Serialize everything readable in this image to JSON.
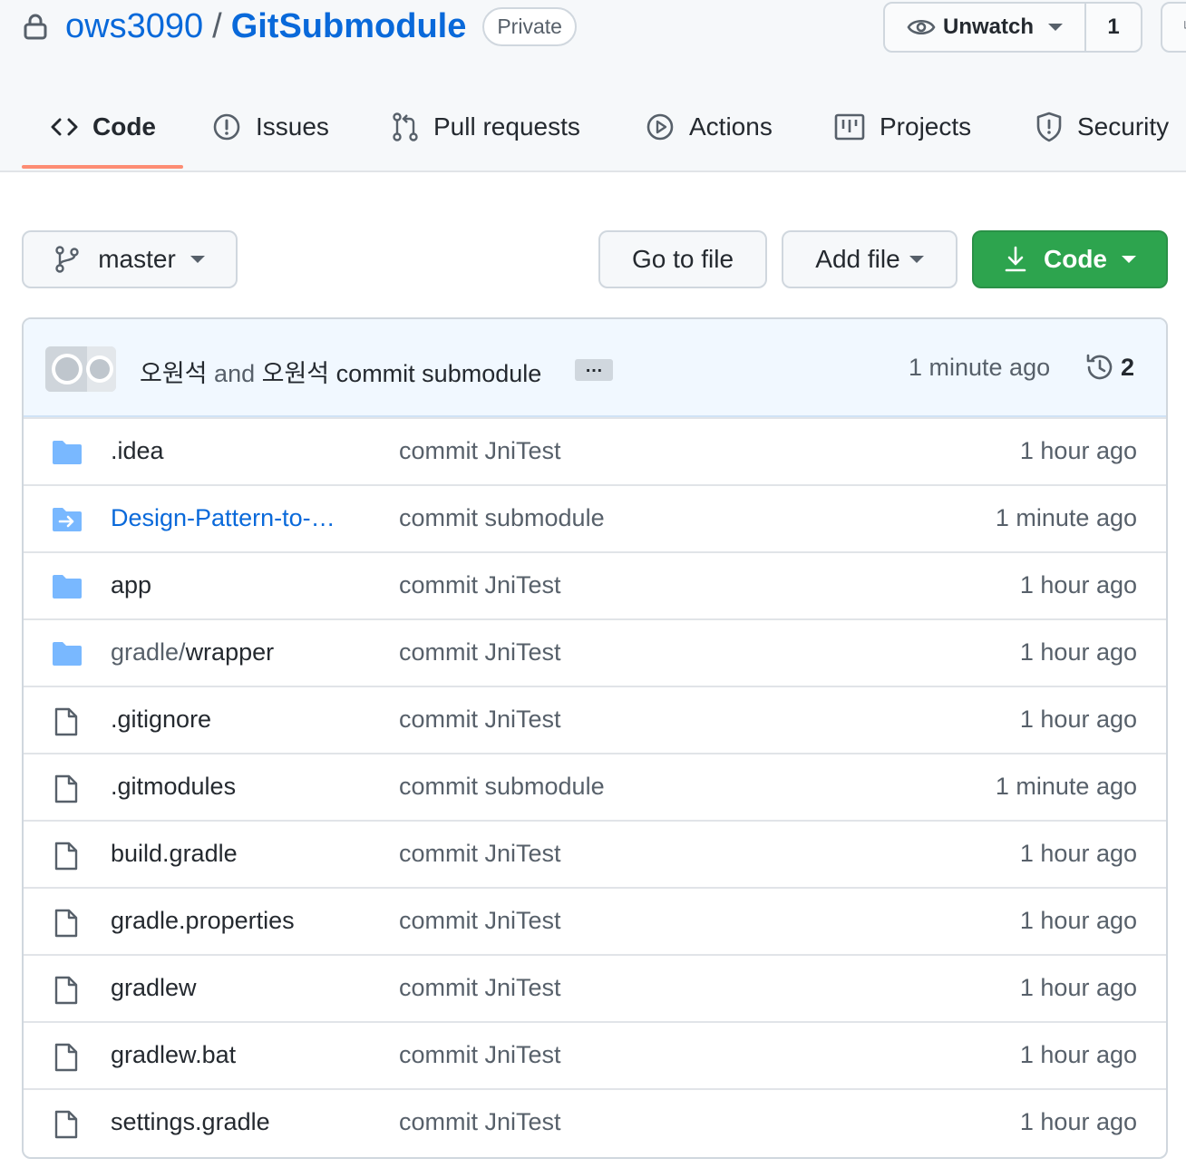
{
  "repo": {
    "owner": "ows3090",
    "separator": "/",
    "name": "GitSubmodule",
    "visibility": "Private"
  },
  "watch": {
    "label": "Unwatch",
    "count": "1"
  },
  "tabs": [
    {
      "label": "Code",
      "icon": "code-icon"
    },
    {
      "label": "Issues",
      "icon": "issue-icon"
    },
    {
      "label": "Pull requests",
      "icon": "pull-request-icon"
    },
    {
      "label": "Actions",
      "icon": "play-icon"
    },
    {
      "label": "Projects",
      "icon": "project-icon"
    },
    {
      "label": "Security",
      "icon": "shield-icon"
    }
  ],
  "toolbar": {
    "branch": "master",
    "go_to_file": "Go to file",
    "add_file": "Add file",
    "code": "Code"
  },
  "latest_commit": {
    "author1": "오원석",
    "and": "and",
    "author2": "오원석",
    "message": "commit submodule",
    "ellipsis": "…",
    "time": "1 minute ago",
    "commit_count": "2"
  },
  "files": [
    {
      "type": "folder",
      "name": ".idea",
      "message": "commit JniTest",
      "time": "1 hour ago"
    },
    {
      "type": "submodule",
      "name": "Design-Pattern-to-…",
      "message": "commit submodule",
      "time": "1 minute ago"
    },
    {
      "type": "folder",
      "name": "app",
      "message": "commit JniTest",
      "time": "1 hour ago"
    },
    {
      "type": "folder",
      "name_prefix": "gradle/",
      "name": "wrapper",
      "message": "commit JniTest",
      "time": "1 hour ago"
    },
    {
      "type": "file",
      "name": ".gitignore",
      "message": "commit JniTest",
      "time": "1 hour ago"
    },
    {
      "type": "file",
      "name": ".gitmodules",
      "message": "commit submodule",
      "time": "1 minute ago"
    },
    {
      "type": "file",
      "name": "build.gradle",
      "message": "commit JniTest",
      "time": "1 hour ago"
    },
    {
      "type": "file",
      "name": "gradle.properties",
      "message": "commit JniTest",
      "time": "1 hour ago"
    },
    {
      "type": "file",
      "name": "gradlew",
      "message": "commit JniTest",
      "time": "1 hour ago"
    },
    {
      "type": "file",
      "name": "gradlew.bat",
      "message": "commit JniTest",
      "time": "1 hour ago"
    },
    {
      "type": "file",
      "name": "settings.gradle",
      "message": "commit JniTest",
      "time": "1 hour ago"
    }
  ],
  "colors": {
    "link": "#0969da",
    "folder": "#79b8ff",
    "primary_button": "#2da44e",
    "active_tab_underline": "#fd8c73"
  }
}
